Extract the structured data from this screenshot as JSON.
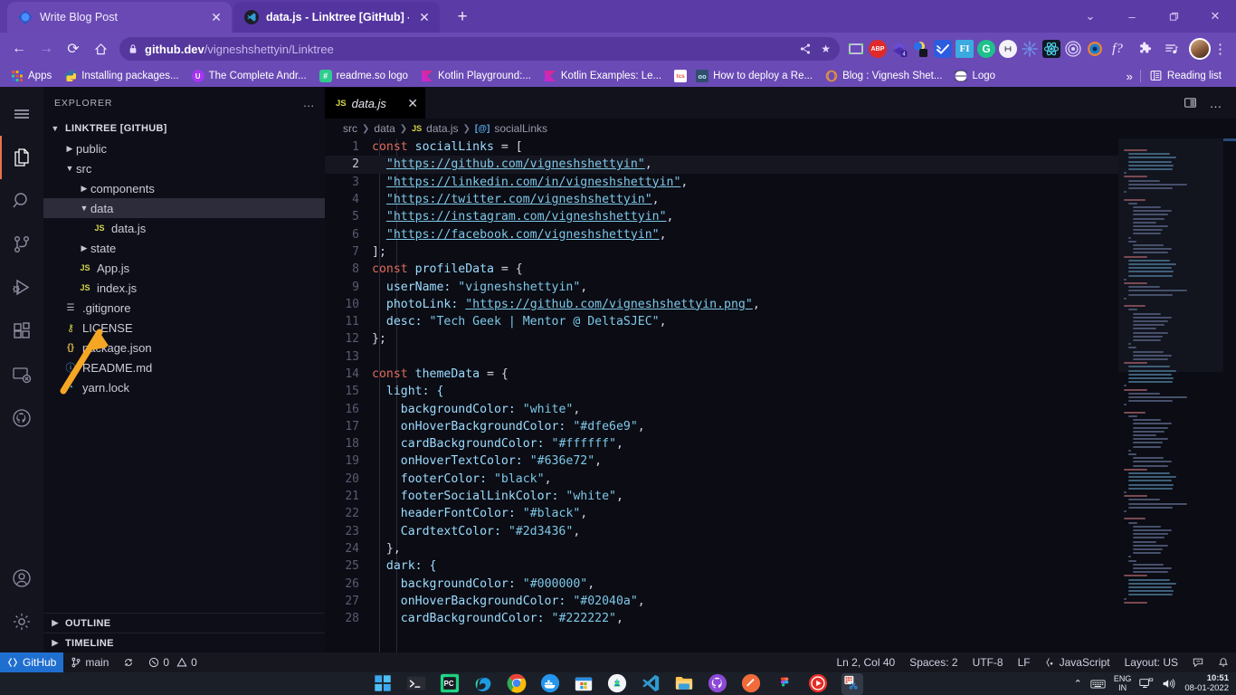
{
  "browser": {
    "tabs": [
      {
        "title": "Write Blog Post",
        "active": false,
        "favicon_color": "#2b66f6",
        "favicon": "blog-icon"
      },
      {
        "title": "data.js - Linktree [GitHub] - Visua",
        "active": true,
        "favicon_color": "#1b1b2a",
        "favicon": "vscode-icon"
      }
    ],
    "new_tab_label": "+",
    "window_controls": {
      "collapse": "⌄",
      "minimize": "–",
      "maximize": "❐",
      "close": "✕"
    },
    "nav": {
      "back": "←",
      "forward": "→",
      "reload": "⟳",
      "home": "⌂"
    },
    "address": {
      "lock": "🔒",
      "domain": "github.dev",
      "path": "/vigneshshettyin/Linktree"
    },
    "omni_actions": {
      "share": "share-icon",
      "bookmark": "★"
    },
    "extension_icons": [
      "screenshot-icon",
      "adblock-plus-icon",
      "grammarly-icon",
      "moon-dark-mode-icon",
      "checkmark-blue-icon",
      "figma-icon",
      "grammarly-g-icon",
      "loom-icon",
      "sun-icon",
      "react-devtools-icon",
      "target-icon",
      "blog-circle-icon"
    ],
    "toolbar_right": {
      "fonts": "f?",
      "extensions": "puzzle-icon",
      "media": "media-icon",
      "menu": "⋮"
    },
    "bookmarks": [
      {
        "label": "Apps",
        "icon": "apps-grid-icon",
        "color": "#e8523f"
      },
      {
        "label": "Installing packages...",
        "icon": "python-icon",
        "color": "#3572a5"
      },
      {
        "label": "The Complete Andr...",
        "icon": "udemy-icon",
        "color": "#a435f0"
      },
      {
        "label": "readme.so logo",
        "icon": "readme-icon",
        "color": "#2ecc8f"
      },
      {
        "label": "Kotlin Playground:...",
        "icon": "kotlin-icon",
        "color": "#b125ea"
      },
      {
        "label": "Kotlin Examples: Le...",
        "icon": "kotlin-icon",
        "color": "#b125ea"
      },
      {
        "label": "How to deploy a Re...",
        "icon": "tcs-icon",
        "color": "#ffffff"
      },
      {
        "label": "How to deploy a Re...",
        "icon": "oo-icon",
        "color": "#2f4f6f"
      },
      {
        "label": "Blog : Vignesh Shet...",
        "icon": "hashnode-icon",
        "color": "#e8953a"
      },
      {
        "label": "Logo",
        "icon": "globe-icon",
        "color": "#ffffff"
      }
    ],
    "bookmark_overflow": "»",
    "reading_list": {
      "label": "Reading list",
      "icon": "reading-list-icon"
    }
  },
  "vscode": {
    "activity_bar": [
      {
        "name": "menu",
        "icon": "hamburger-icon",
        "active": false
      },
      {
        "name": "explorer",
        "icon": "files-icon",
        "active": true
      },
      {
        "name": "search",
        "icon": "search-icon",
        "active": false
      },
      {
        "name": "source-control",
        "icon": "source-control-icon",
        "active": false
      },
      {
        "name": "run-and-debug",
        "icon": "run-debug-icon",
        "active": false
      },
      {
        "name": "extensions",
        "icon": "extensions-icon",
        "active": false
      },
      {
        "name": "remote-explorer",
        "icon": "remote-icon",
        "active": false
      },
      {
        "name": "github",
        "icon": "github-icon",
        "active": false
      }
    ],
    "activity_bar_bottom": [
      {
        "name": "accounts",
        "icon": "account-icon"
      },
      {
        "name": "settings",
        "icon": "gear-icon"
      }
    ],
    "sidebar": {
      "title": "EXPLORER",
      "more_actions": "…",
      "root_folder": "LINKTREE [GITHUB]",
      "tree": [
        {
          "label": "public",
          "type": "folder",
          "depth": 1,
          "expanded": false,
          "selected": false
        },
        {
          "label": "src",
          "type": "folder",
          "depth": 1,
          "expanded": true,
          "selected": false
        },
        {
          "label": "components",
          "type": "folder",
          "depth": 2,
          "expanded": false,
          "selected": false
        },
        {
          "label": "data",
          "type": "folder",
          "depth": 2,
          "expanded": true,
          "selected": true
        },
        {
          "label": "data.js",
          "type": "js",
          "depth": 3,
          "selected": false
        },
        {
          "label": "state",
          "type": "folder",
          "depth": 2,
          "expanded": false,
          "selected": false
        },
        {
          "label": "App.js",
          "type": "js",
          "depth": 2,
          "selected": false
        },
        {
          "label": "index.js",
          "type": "js",
          "depth": 2,
          "selected": false
        },
        {
          "label": ".gitignore",
          "type": "git",
          "depth": 1,
          "selected": false
        },
        {
          "label": "LICENSE",
          "type": "license",
          "depth": 1,
          "selected": false
        },
        {
          "label": "package.json",
          "type": "json",
          "depth": 1,
          "selected": false
        },
        {
          "label": "README.md",
          "type": "md",
          "depth": 1,
          "selected": false
        },
        {
          "label": "yarn.lock",
          "type": "yarn",
          "depth": 1,
          "selected": false
        }
      ],
      "panels": [
        {
          "label": "OUTLINE",
          "expanded": false
        },
        {
          "label": "TIMELINE",
          "expanded": false
        }
      ]
    },
    "editor": {
      "tab": {
        "label": "data.js",
        "icon": "js-icon",
        "close": "✕",
        "dirty": false
      },
      "actions": {
        "split": "split-editor-icon",
        "more": "…"
      },
      "breadcrumb": [
        "src",
        "data",
        "data.js",
        "socialLinks"
      ],
      "breadcrumb_symbol_icon": "variable-icon",
      "first_line": 1,
      "lines": [
        {
          "n": 1,
          "tokens": [
            {
              "t": "const ",
              "c": "kw"
            },
            {
              "t": "socialLinks ",
              "c": "id"
            },
            {
              "t": "= [",
              "c": "op"
            }
          ],
          "indent": 0
        },
        {
          "n": 2,
          "tokens": [
            {
              "t": "\"https://github.com/vigneshshettyin\"",
              "c": "lnk"
            },
            {
              "t": ",",
              "c": "punc"
            }
          ],
          "indent": 1,
          "highlight": true
        },
        {
          "n": 3,
          "tokens": [
            {
              "t": "\"https://linkedin.com/in/vigneshshettyin\"",
              "c": "lnk"
            },
            {
              "t": ",",
              "c": "punc"
            }
          ],
          "indent": 1
        },
        {
          "n": 4,
          "tokens": [
            {
              "t": "\"https://twitter.com/vigneshshettyin\"",
              "c": "lnk"
            },
            {
              "t": ",",
              "c": "punc"
            }
          ],
          "indent": 1
        },
        {
          "n": 5,
          "tokens": [
            {
              "t": "\"https://instagram.com/vigneshshettyin\"",
              "c": "lnk"
            },
            {
              "t": ",",
              "c": "punc"
            }
          ],
          "indent": 1
        },
        {
          "n": 6,
          "tokens": [
            {
              "t": "\"https://facebook.com/vigneshshettyin\"",
              "c": "lnk"
            },
            {
              "t": ",",
              "c": "punc"
            }
          ],
          "indent": 1
        },
        {
          "n": 7,
          "tokens": [
            {
              "t": "];",
              "c": "punc"
            }
          ],
          "indent": 0
        },
        {
          "n": 8,
          "tokens": [
            {
              "t": "const ",
              "c": "kw"
            },
            {
              "t": "profileData ",
              "c": "id"
            },
            {
              "t": "= {",
              "c": "op"
            }
          ],
          "indent": 0
        },
        {
          "n": 9,
          "tokens": [
            {
              "t": "userName: ",
              "c": "prop"
            },
            {
              "t": "\"vigneshshettyin\"",
              "c": "str"
            },
            {
              "t": ",",
              "c": "punc"
            }
          ],
          "indent": 1
        },
        {
          "n": 10,
          "tokens": [
            {
              "t": "photoLink: ",
              "c": "prop"
            },
            {
              "t": "\"https://github.com/vigneshshettyin.png\"",
              "c": "lnk"
            },
            {
              "t": ",",
              "c": "punc"
            }
          ],
          "indent": 1
        },
        {
          "n": 11,
          "tokens": [
            {
              "t": "desc: ",
              "c": "prop"
            },
            {
              "t": "\"Tech Geek | Mentor @ DeltaSJEC\"",
              "c": "str"
            },
            {
              "t": ",",
              "c": "punc"
            }
          ],
          "indent": 1
        },
        {
          "n": 12,
          "tokens": [
            {
              "t": "};",
              "c": "punc"
            }
          ],
          "indent": 0
        },
        {
          "n": 13,
          "tokens": [],
          "indent": 0
        },
        {
          "n": 14,
          "tokens": [
            {
              "t": "const ",
              "c": "kw"
            },
            {
              "t": "themeData ",
              "c": "id"
            },
            {
              "t": "= {",
              "c": "op"
            }
          ],
          "indent": 0
        },
        {
          "n": 15,
          "tokens": [
            {
              "t": "light: {",
              "c": "prop"
            }
          ],
          "indent": 1
        },
        {
          "n": 16,
          "tokens": [
            {
              "t": "backgroundColor: ",
              "c": "prop"
            },
            {
              "t": "\"white\"",
              "c": "str"
            },
            {
              "t": ",",
              "c": "punc"
            }
          ],
          "indent": 2
        },
        {
          "n": 17,
          "tokens": [
            {
              "t": "onHoverBackgroundColor: ",
              "c": "prop"
            },
            {
              "t": "\"#dfe6e9\"",
              "c": "str"
            },
            {
              "t": ",",
              "c": "punc"
            }
          ],
          "indent": 2
        },
        {
          "n": 18,
          "tokens": [
            {
              "t": "cardBackgroundColor: ",
              "c": "prop"
            },
            {
              "t": "\"#ffffff\"",
              "c": "str"
            },
            {
              "t": ",",
              "c": "punc"
            }
          ],
          "indent": 2
        },
        {
          "n": 19,
          "tokens": [
            {
              "t": "onHoverTextColor: ",
              "c": "prop"
            },
            {
              "t": "\"#636e72\"",
              "c": "str"
            },
            {
              "t": ",",
              "c": "punc"
            }
          ],
          "indent": 2
        },
        {
          "n": 20,
          "tokens": [
            {
              "t": "footerColor: ",
              "c": "prop"
            },
            {
              "t": "\"black\"",
              "c": "str"
            },
            {
              "t": ",",
              "c": "punc"
            }
          ],
          "indent": 2
        },
        {
          "n": 21,
          "tokens": [
            {
              "t": "footerSocialLinkColor: ",
              "c": "prop"
            },
            {
              "t": "\"white\"",
              "c": "str"
            },
            {
              "t": ",",
              "c": "punc"
            }
          ],
          "indent": 2
        },
        {
          "n": 22,
          "tokens": [
            {
              "t": "headerFontColor: ",
              "c": "prop"
            },
            {
              "t": "\"#black\"",
              "c": "str"
            },
            {
              "t": ",",
              "c": "punc"
            }
          ],
          "indent": 2
        },
        {
          "n": 23,
          "tokens": [
            {
              "t": "CardtextColor: ",
              "c": "prop"
            },
            {
              "t": "\"#2d3436\"",
              "c": "str"
            },
            {
              "t": ",",
              "c": "punc"
            }
          ],
          "indent": 2
        },
        {
          "n": 24,
          "tokens": [
            {
              "t": "},",
              "c": "punc"
            }
          ],
          "indent": 1
        },
        {
          "n": 25,
          "tokens": [
            {
              "t": "dark: {",
              "c": "prop"
            }
          ],
          "indent": 1
        },
        {
          "n": 26,
          "tokens": [
            {
              "t": "backgroundColor: ",
              "c": "prop"
            },
            {
              "t": "\"#000000\"",
              "c": "str"
            },
            {
              "t": ",",
              "c": "punc"
            }
          ],
          "indent": 2
        },
        {
          "n": 27,
          "tokens": [
            {
              "t": "onHoverBackgroundColor: ",
              "c": "prop"
            },
            {
              "t": "\"#02040a\"",
              "c": "str"
            },
            {
              "t": ",",
              "c": "punc"
            }
          ],
          "indent": 2
        },
        {
          "n": 28,
          "tokens": [
            {
              "t": "cardBackgroundColor: ",
              "c": "prop"
            },
            {
              "t": "\"#222222\"",
              "c": "str"
            },
            {
              "t": ",",
              "c": "punc"
            }
          ],
          "indent": 2
        }
      ]
    },
    "status_bar": {
      "remote": {
        "label": "GitHub",
        "icon": "remote-icon"
      },
      "branch": {
        "label": "main",
        "icon": "branch-icon"
      },
      "sync": {
        "icon": "sync-icon"
      },
      "problems": {
        "errors": "0",
        "warnings": "0",
        "error_icon": "error-icon",
        "warning_icon": "warning-icon"
      },
      "right": [
        {
          "name": "cursor-position",
          "label": "Ln 2, Col 40"
        },
        {
          "name": "indentation",
          "label": "Spaces: 2"
        },
        {
          "name": "encoding",
          "label": "UTF-8"
        },
        {
          "name": "eol",
          "label": "LF"
        },
        {
          "name": "language-mode",
          "label": "JavaScript",
          "icon": "js-braces-icon"
        },
        {
          "name": "keyboard-layout",
          "label": "Layout: US"
        }
      ],
      "feedback_icon": "feedback-icon",
      "bell_icon": "bell-icon"
    }
  },
  "taskbar": {
    "icons": [
      {
        "name": "start-windows-icon",
        "color": "#36a0e8",
        "running": false
      },
      {
        "name": "terminal-icon",
        "color": "#2b2b2b",
        "running": false
      },
      {
        "name": "pycharm-icon",
        "color": "#21d789",
        "running": false
      },
      {
        "name": "edge-icon",
        "color": "#1e9ae0",
        "running": false
      },
      {
        "name": "chrome-icon",
        "color": "#f4b400",
        "running": true
      },
      {
        "name": "docker-icon",
        "color": "#2496ed",
        "running": false
      },
      {
        "name": "microsoft-store-icon",
        "color": "#ffffff",
        "running": false
      },
      {
        "name": "android-studio-icon",
        "color": "#ffffff",
        "running": false
      },
      {
        "name": "vscode-icon",
        "color": "#2f9ad0",
        "running": false
      },
      {
        "name": "file-explorer-icon",
        "color": "#ffc452",
        "running": true
      },
      {
        "name": "github-desktop-icon",
        "color": "#8b49d6",
        "running": false
      },
      {
        "name": "postman-icon",
        "color": "#f26b3a",
        "running": false
      },
      {
        "name": "figma-icon",
        "color": "#1e1e1e",
        "running": true
      },
      {
        "name": "youtube-music-icon",
        "color": "#e52d27",
        "running": true
      },
      {
        "name": "snipping-tool-icon",
        "color": "#e8e8e8",
        "running": true,
        "active": true
      }
    ],
    "tray": {
      "overflow": "⌃",
      "keyboard_icon": "keyboard-icon",
      "language": {
        "line1": "ENG",
        "line2": "IN"
      },
      "network_icon": "network-icon",
      "volume_icon": "volume-icon",
      "time": "10:51",
      "date": "08-01-2022"
    }
  },
  "annotation": {
    "type": "arrow",
    "color": "#f5a623",
    "points_to": "data.js"
  }
}
